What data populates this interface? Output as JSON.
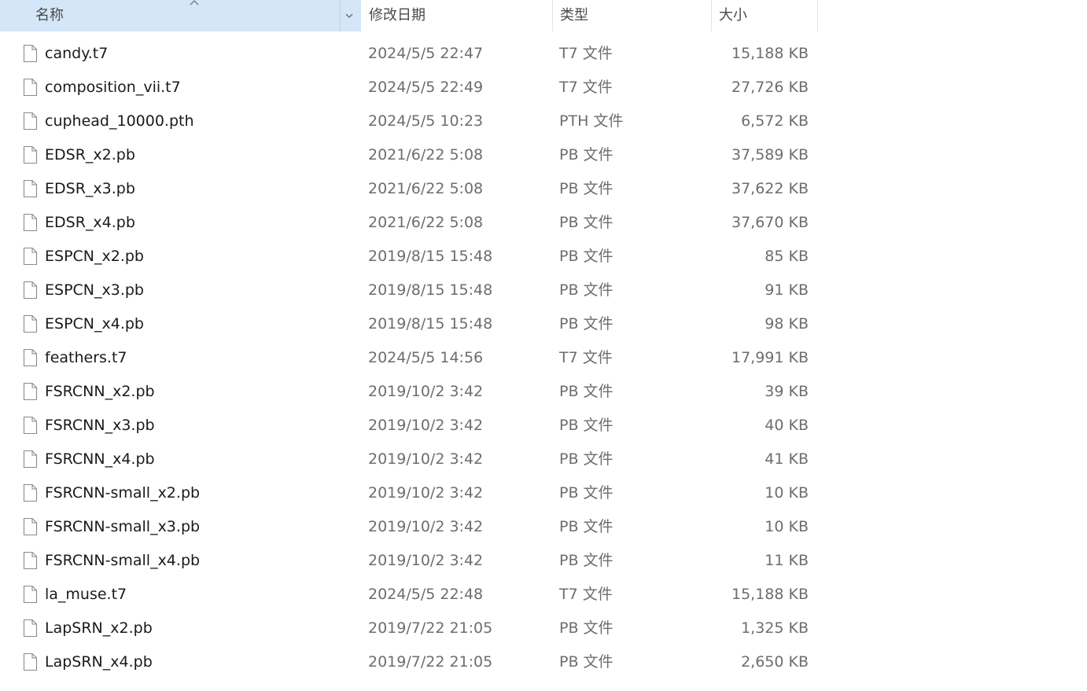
{
  "header": {
    "name": "名称",
    "date": "修改日期",
    "type": "类型",
    "size": "大小"
  },
  "icons": {
    "file": "file-icon",
    "sort": "sort-ascending-icon",
    "dropdown": "chevron-down-icon"
  },
  "colors": {
    "header_selected_bg": "#d4e6f7",
    "secondary_text": "#6d6d6d"
  },
  "files": [
    {
      "name": "candy.t7",
      "date": "2024/5/5 22:47",
      "type": "T7 文件",
      "size": "15,188 KB"
    },
    {
      "name": "composition_vii.t7",
      "date": "2024/5/5 22:49",
      "type": "T7 文件",
      "size": "27,726 KB"
    },
    {
      "name": "cuphead_10000.pth",
      "date": "2024/5/5 10:23",
      "type": "PTH 文件",
      "size": "6,572 KB"
    },
    {
      "name": "EDSR_x2.pb",
      "date": "2021/6/22 5:08",
      "type": "PB 文件",
      "size": "37,589 KB"
    },
    {
      "name": "EDSR_x3.pb",
      "date": "2021/6/22 5:08",
      "type": "PB 文件",
      "size": "37,622 KB"
    },
    {
      "name": "EDSR_x4.pb",
      "date": "2021/6/22 5:08",
      "type": "PB 文件",
      "size": "37,670 KB"
    },
    {
      "name": "ESPCN_x2.pb",
      "date": "2019/8/15 15:48",
      "type": "PB 文件",
      "size": "85 KB"
    },
    {
      "name": "ESPCN_x3.pb",
      "date": "2019/8/15 15:48",
      "type": "PB 文件",
      "size": "91 KB"
    },
    {
      "name": "ESPCN_x4.pb",
      "date": "2019/8/15 15:48",
      "type": "PB 文件",
      "size": "98 KB"
    },
    {
      "name": "feathers.t7",
      "date": "2024/5/5 14:56",
      "type": "T7 文件",
      "size": "17,991 KB"
    },
    {
      "name": "FSRCNN_x2.pb",
      "date": "2019/10/2 3:42",
      "type": "PB 文件",
      "size": "39 KB"
    },
    {
      "name": "FSRCNN_x3.pb",
      "date": "2019/10/2 3:42",
      "type": "PB 文件",
      "size": "40 KB"
    },
    {
      "name": "FSRCNN_x4.pb",
      "date": "2019/10/2 3:42",
      "type": "PB 文件",
      "size": "41 KB"
    },
    {
      "name": "FSRCNN-small_x2.pb",
      "date": "2019/10/2 3:42",
      "type": "PB 文件",
      "size": "10 KB"
    },
    {
      "name": "FSRCNN-small_x3.pb",
      "date": "2019/10/2 3:42",
      "type": "PB 文件",
      "size": "10 KB"
    },
    {
      "name": "FSRCNN-small_x4.pb",
      "date": "2019/10/2 3:42",
      "type": "PB 文件",
      "size": "11 KB"
    },
    {
      "name": "la_muse.t7",
      "date": "2024/5/5 22:48",
      "type": "T7 文件",
      "size": "15,188 KB"
    },
    {
      "name": "LapSRN_x2.pb",
      "date": "2019/7/22 21:05",
      "type": "PB 文件",
      "size": "1,325 KB"
    },
    {
      "name": "LapSRN_x4.pb",
      "date": "2019/7/22 21:05",
      "type": "PB 文件",
      "size": "2,650 KB"
    }
  ]
}
